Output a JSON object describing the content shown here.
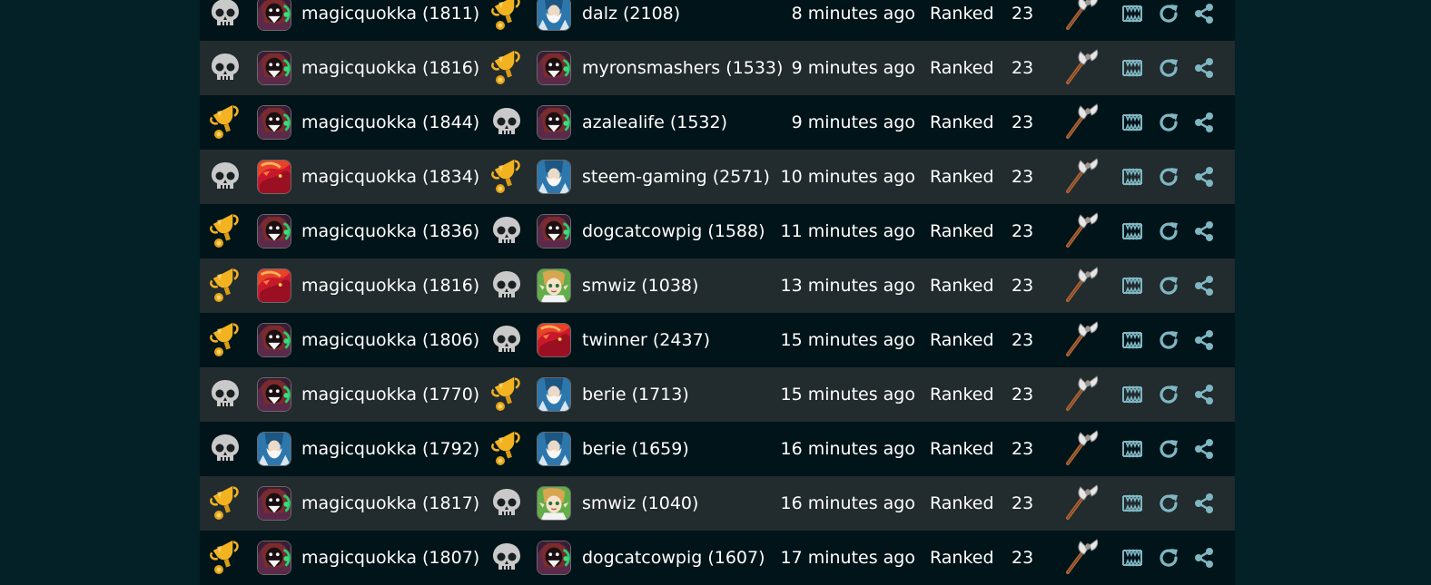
{
  "colors": {
    "row_dark": "#011419",
    "row_light": "#222b2e",
    "page_bg": "#032126",
    "icon_teal": "#7fb6c2",
    "win_gold": "#f3b321",
    "skull_gray": "#c9c9c9"
  },
  "battles": [
    {
      "p1_result": "skull",
      "p1_avatar": "reaper",
      "p1_name": "magicquokka (1811)",
      "p2_result": "trophy",
      "p2_avatar": "wizard",
      "p2_name": "dalz (2108)",
      "time": "8 minutes ago",
      "mode": "Ranked",
      "mana": "23"
    },
    {
      "p1_result": "skull",
      "p1_avatar": "reaper",
      "p1_name": "magicquokka (1816)",
      "p2_result": "trophy",
      "p2_avatar": "reaper",
      "p2_name": "myronsmashers (1533)",
      "time": "9 minutes ago",
      "mode": "Ranked",
      "mana": "23"
    },
    {
      "p1_result": "trophy",
      "p1_avatar": "reaper",
      "p1_name": "magicquokka (1844)",
      "p2_result": "skull",
      "p2_avatar": "reaper",
      "p2_name": "azalealife (1532)",
      "time": "9 minutes ago",
      "mode": "Ranked",
      "mana": "23"
    },
    {
      "p1_result": "skull",
      "p1_avatar": "dragon",
      "p1_name": "magicquokka (1834)",
      "p2_result": "trophy",
      "p2_avatar": "wizard",
      "p2_name": "steem-gaming (2571)",
      "time": "10 minutes ago",
      "mode": "Ranked",
      "mana": "23"
    },
    {
      "p1_result": "trophy",
      "p1_avatar": "reaper",
      "p1_name": "magicquokka (1836)",
      "p2_result": "skull",
      "p2_avatar": "reaper",
      "p2_name": "dogcatcowpig (1588)",
      "time": "11 minutes ago",
      "mode": "Ranked",
      "mana": "23"
    },
    {
      "p1_result": "trophy",
      "p1_avatar": "dragon",
      "p1_name": "magicquokka (1816)",
      "p2_result": "skull",
      "p2_avatar": "elf",
      "p2_name": "smwiz (1038)",
      "time": "13 minutes ago",
      "mode": "Ranked",
      "mana": "23"
    },
    {
      "p1_result": "trophy",
      "p1_avatar": "reaper",
      "p1_name": "magicquokka (1806)",
      "p2_result": "skull",
      "p2_avatar": "dragon",
      "p2_name": "twinner (2437)",
      "time": "15 minutes ago",
      "mode": "Ranked",
      "mana": "23"
    },
    {
      "p1_result": "skull",
      "p1_avatar": "reaper",
      "p1_name": "magicquokka (1770)",
      "p2_result": "trophy",
      "p2_avatar": "wizard",
      "p2_name": "berie (1713)",
      "time": "15 minutes ago",
      "mode": "Ranked",
      "mana": "23"
    },
    {
      "p1_result": "skull",
      "p1_avatar": "wizard",
      "p1_name": "magicquokka (1792)",
      "p2_result": "trophy",
      "p2_avatar": "wizard",
      "p2_name": "berie (1659)",
      "time": "16 minutes ago",
      "mode": "Ranked",
      "mana": "23"
    },
    {
      "p1_result": "trophy",
      "p1_avatar": "reaper",
      "p1_name": "magicquokka (1817)",
      "p2_result": "skull",
      "p2_avatar": "elf",
      "p2_name": "smwiz (1040)",
      "time": "16 minutes ago",
      "mode": "Ranked",
      "mana": "23"
    },
    {
      "p1_result": "trophy",
      "p1_avatar": "reaper",
      "p1_name": "magicquokka (1807)",
      "p2_result": "skull",
      "p2_avatar": "reaper",
      "p2_name": "dogcatcowpig (1607)",
      "time": "17 minutes ago",
      "mode": "Ranked",
      "mana": "23"
    }
  ],
  "row_icons": {
    "ruleset": "axe-icon",
    "view": "fangs-icon",
    "replay": "replay-icon",
    "share": "share-icon"
  }
}
